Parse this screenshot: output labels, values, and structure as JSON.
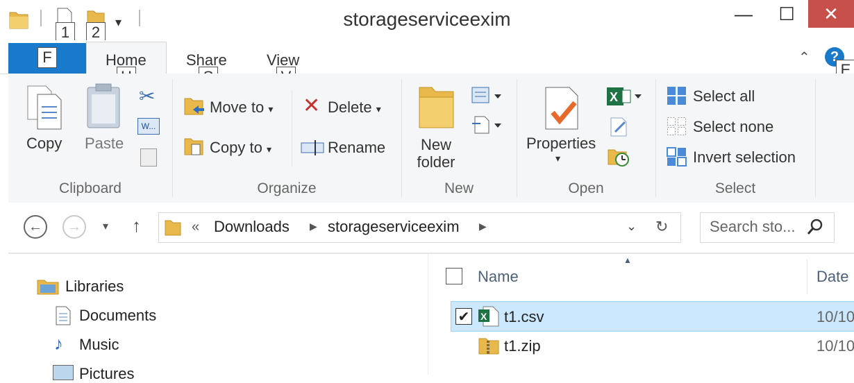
{
  "window": {
    "title": "storageserviceexim",
    "minimize_glyph": "—",
    "maximize_glyph": "☐",
    "close_glyph": "✕"
  },
  "qat": {
    "keytip_1": "1",
    "keytip_2": "2"
  },
  "tabs": [
    {
      "label": "F",
      "keytip": "F"
    },
    {
      "label": "Home",
      "keytip": "H"
    },
    {
      "label": "Share",
      "keytip": "S"
    },
    {
      "label": "View",
      "keytip": "V"
    }
  ],
  "help_keytip": "E",
  "ribbon": {
    "clipboard": {
      "label": "Clipboard",
      "copy": "Copy",
      "paste": "Paste"
    },
    "organize": {
      "label": "Organize",
      "move_to": "Move to",
      "copy_to": "Copy to",
      "delete": "Delete",
      "rename": "Rename"
    },
    "new": {
      "label": "New",
      "new_folder_1": "New",
      "new_folder_2": "folder"
    },
    "open": {
      "label": "Open",
      "properties": "Properties"
    },
    "select": {
      "label": "Select",
      "select_all": "Select all",
      "select_none": "Select none",
      "invert": "Invert selection"
    }
  },
  "address": {
    "chev": "«",
    "crumbs": [
      "Downloads",
      "storageserviceexim"
    ]
  },
  "search": {
    "placeholder": "Search sto..."
  },
  "navpane": {
    "items": [
      "Libraries",
      "Documents",
      "Music",
      "Pictures"
    ]
  },
  "columns": {
    "name": "Name",
    "date": "Date"
  },
  "files": [
    {
      "name": "t1.csv",
      "date": "10/10",
      "selected": true
    },
    {
      "name": "t1.zip",
      "date": "10/10",
      "selected": false
    }
  ],
  "colors": {
    "accent": "#1979ca",
    "selection": "#cce8ff",
    "close": "#c7504a"
  }
}
